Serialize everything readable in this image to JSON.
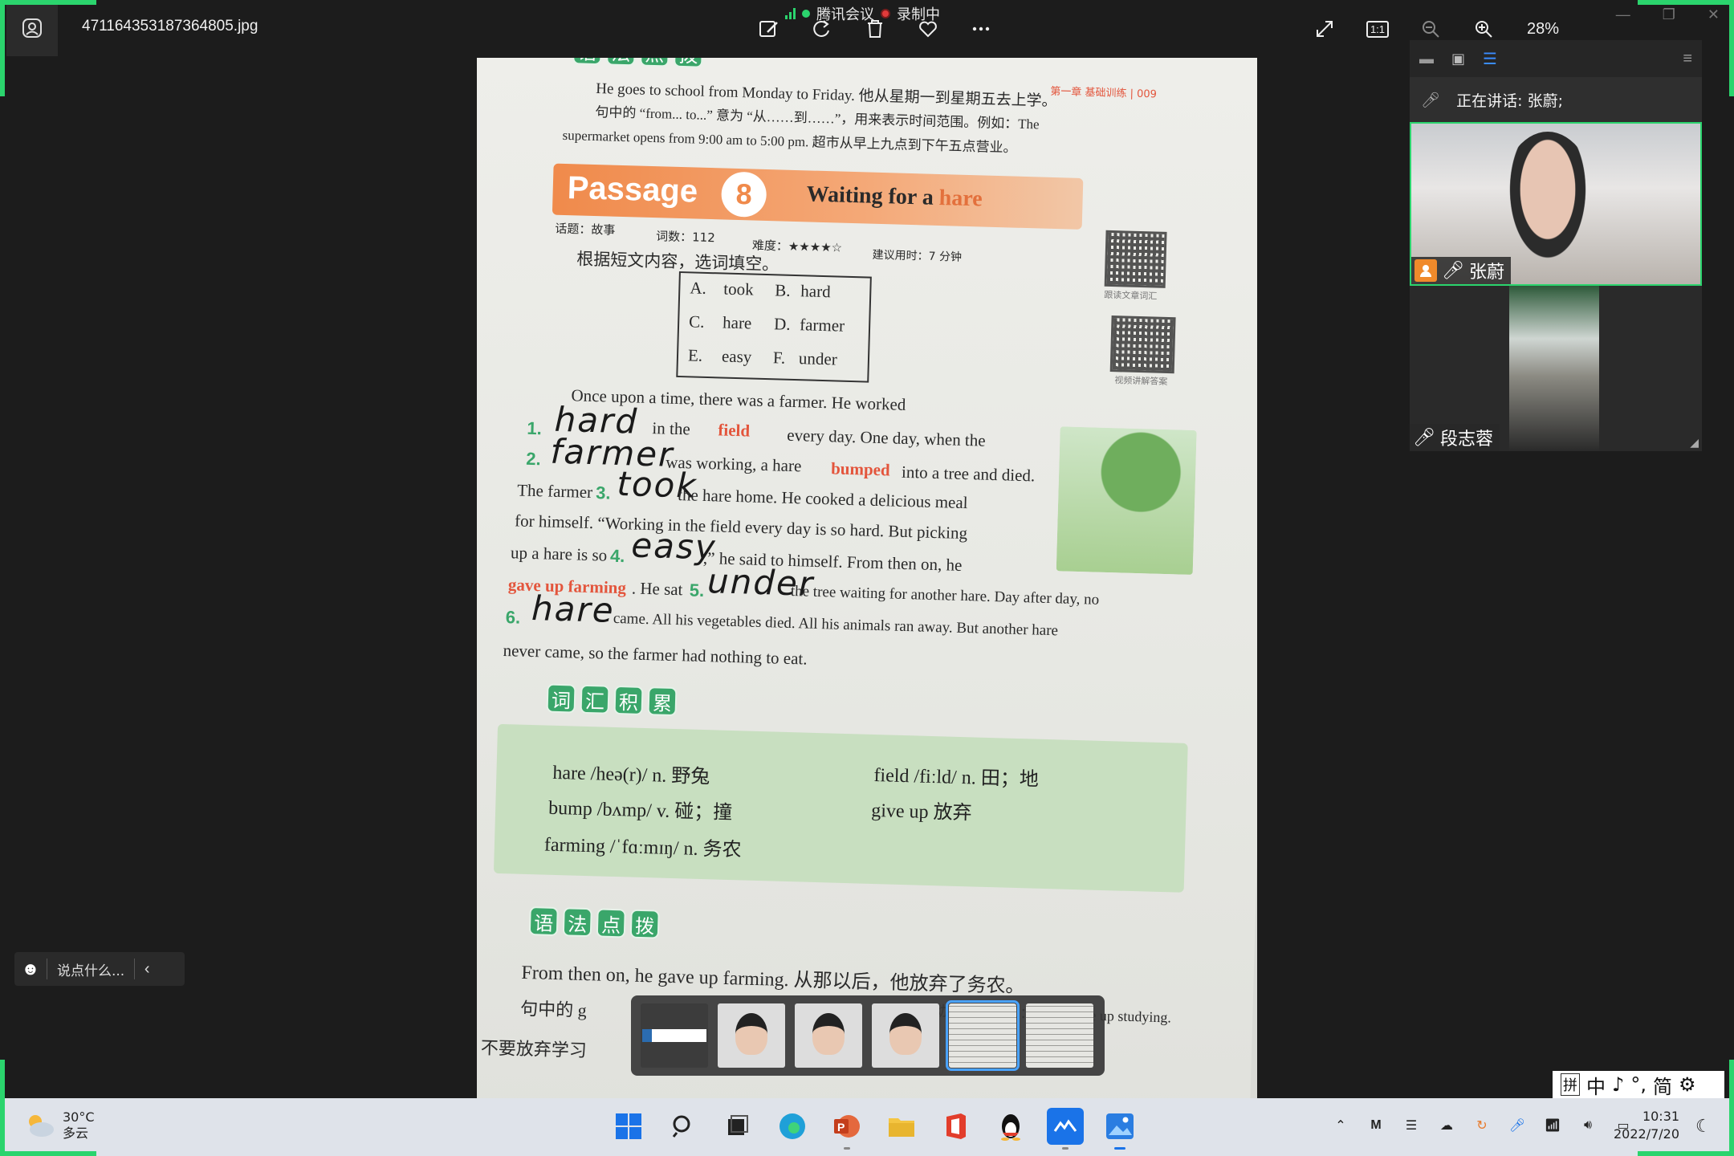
{
  "viewer": {
    "filename": "471164353187364805.jpg",
    "zoom": "28%",
    "meeting_app": "腾讯会议",
    "recording": "录制中",
    "one_to_one": "1:1"
  },
  "meeting": {
    "speaking": "正在讲话: 张蔚;",
    "participants": [
      {
        "name": "张蔚",
        "is_host": true
      },
      {
        "name": "段志蓉",
        "is_host": false
      }
    ]
  },
  "chat": {
    "placeholder": "说点什么..."
  },
  "book_page": {
    "header_right": "第一章  基础训练 | 009",
    "grammar_tip_label": [
      "语",
      "法",
      "点",
      "拨"
    ],
    "grammar_top": [
      "He goes to school from Monday to Friday. 他从星期一到星期五去上学。",
      "句中的 “from... to...” 意为 “从……到……”，用来表示时间范围。例如：The",
      "supermarket opens from 9:00 am to 5:00 pm. 超市从早上九点到下午五点营业。"
    ],
    "passage_word": "Passage",
    "passage_number": "8",
    "passage_title_prefix": "Waiting for a",
    "passage_title_hl": "hare",
    "meta": {
      "topic": "话题：故事",
      "word_count": "词数：112",
      "difficulty": "难度：★★★★☆",
      "time": "建议用时：7 分钟"
    },
    "instruction": "根据短文内容，选词填空。",
    "qr_label_1": "跟读文章词汇",
    "qr_label_2": "视频讲解答案",
    "options": [
      {
        "letter": "A.",
        "word": "took"
      },
      {
        "letter": "B.",
        "word": "hard"
      },
      {
        "letter": "C.",
        "word": "hare"
      },
      {
        "letter": "D.",
        "word": "farmer"
      },
      {
        "letter": "E.",
        "word": "easy"
      },
      {
        "letter": "F.",
        "word": "under"
      }
    ],
    "passage_lines": [
      "Once  upon  a  time,  there  was  a  farmer.  He  worked",
      "in  the",
      "every  day.  One  day,  when  the",
      "was working, a hare",
      "into a tree and died.",
      "The farmer",
      "the hare home. He cooked a delicious meal",
      "for himself. “Working in the field every day is so hard. But picking",
      "up a hare is so",
      ",” he said to himself. From then on, he",
      "gave up farming",
      ". He sat",
      "the tree waiting for another hare. Day after day, no",
      "came. All his vegetables died. All his animals ran away. But another hare",
      "never came, so the farmer had nothing to eat."
    ],
    "red_words": {
      "field": "field",
      "bumped": "bumped"
    },
    "blank_numbers": [
      "1.",
      "2.",
      "3.",
      "4.",
      "5.",
      "6."
    ],
    "handwritten": [
      "hard",
      "farmer",
      "took",
      "easy",
      "under",
      "hare"
    ],
    "vocab_label": [
      "词",
      "汇",
      "积",
      "累"
    ],
    "vocab": [
      "hare /heə(r)/  n.  野兔",
      "bump /bʌmp/  v.  碰；撞",
      "farming /ˈfɑːmɪŋ/  n.  务农",
      "field /fiːld/  n.  田；地",
      "give up  放弃"
    ],
    "grammar_bottom": [
      "From then on, he gave up farming. 从那以后，他放弃了务农。",
      "句中的 g",
      "不要放弃学习",
      "…动名词。例如：Don’t give up studying."
    ]
  },
  "taskbar": {
    "temperature": "30°C",
    "weather": "多云",
    "time": "10:31",
    "date": "2022/7/20"
  },
  "ime": [
    "拼",
    "中",
    "♪",
    "°,",
    "简",
    "⚙"
  ],
  "colors": {
    "recording_green": "#2bd46d",
    "accent_orange": "#f08a4b",
    "tip_green": "#3aa66a",
    "selection_blue": "#4aa3ff"
  }
}
